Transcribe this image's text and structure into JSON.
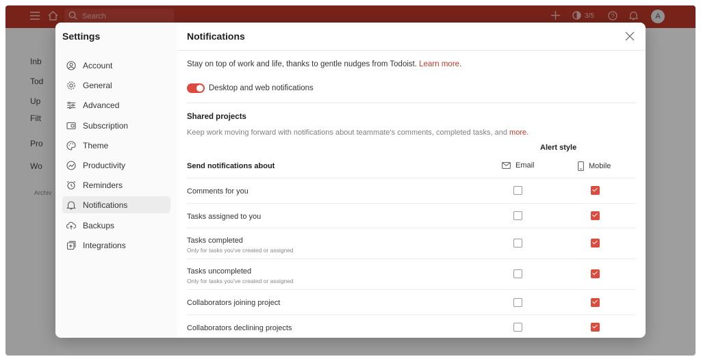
{
  "app": {
    "search_placeholder": "Search",
    "karma": "3/5",
    "avatar_initial": "A",
    "sidebar_peek": [
      "Inb",
      "Tod",
      "Up",
      "Filt",
      "Pro",
      "Wo",
      "Archiv"
    ]
  },
  "settings": {
    "title": "Settings",
    "nav": [
      {
        "label": "Account",
        "icon": "account-icon"
      },
      {
        "label": "General",
        "icon": "gear-icon"
      },
      {
        "label": "Advanced",
        "icon": "sliders-icon"
      },
      {
        "label": "Subscription",
        "icon": "subscription-icon"
      },
      {
        "label": "Theme",
        "icon": "palette-icon"
      },
      {
        "label": "Productivity",
        "icon": "productivity-icon"
      },
      {
        "label": "Reminders",
        "icon": "alarm-icon"
      },
      {
        "label": "Notifications",
        "icon": "bell-icon",
        "active": true
      },
      {
        "label": "Backups",
        "icon": "cloud-upload-icon"
      },
      {
        "label": "Integrations",
        "icon": "integrations-icon"
      }
    ]
  },
  "notifications": {
    "title": "Notifications",
    "intro_text": "Stay on top of work and life, thanks to gentle nudges from Todoist.",
    "intro_link": "Learn more",
    "desktop_toggle_label": "Desktop and web notifications",
    "desktop_toggle_on": true,
    "shared_title": "Shared projects",
    "shared_desc": "Keep work moving forward with notifications about teammate's comments, completed tasks, and",
    "shared_desc_link": "more.",
    "alert_style": "Alert style",
    "send_about": "Send notifications about",
    "email_label": "Email",
    "mobile_label": "Mobile",
    "rows": [
      {
        "label": "Comments for you",
        "sub": "",
        "email": false,
        "mobile": true
      },
      {
        "label": "Tasks assigned to you",
        "sub": "",
        "email": false,
        "mobile": true
      },
      {
        "label": "Tasks completed",
        "sub": "Only for tasks you've created or assigned",
        "email": false,
        "mobile": true
      },
      {
        "label": "Tasks uncompleted",
        "sub": "Only for tasks you've created or assigned",
        "email": false,
        "mobile": true
      },
      {
        "label": "Collaborators joining project",
        "sub": "",
        "email": false,
        "mobile": true
      },
      {
        "label": "Collaborators declining projects",
        "sub": "",
        "email": false,
        "mobile": true
      }
    ]
  },
  "colors": {
    "brand": "#c0392b",
    "accent": "#dc4c3e"
  }
}
